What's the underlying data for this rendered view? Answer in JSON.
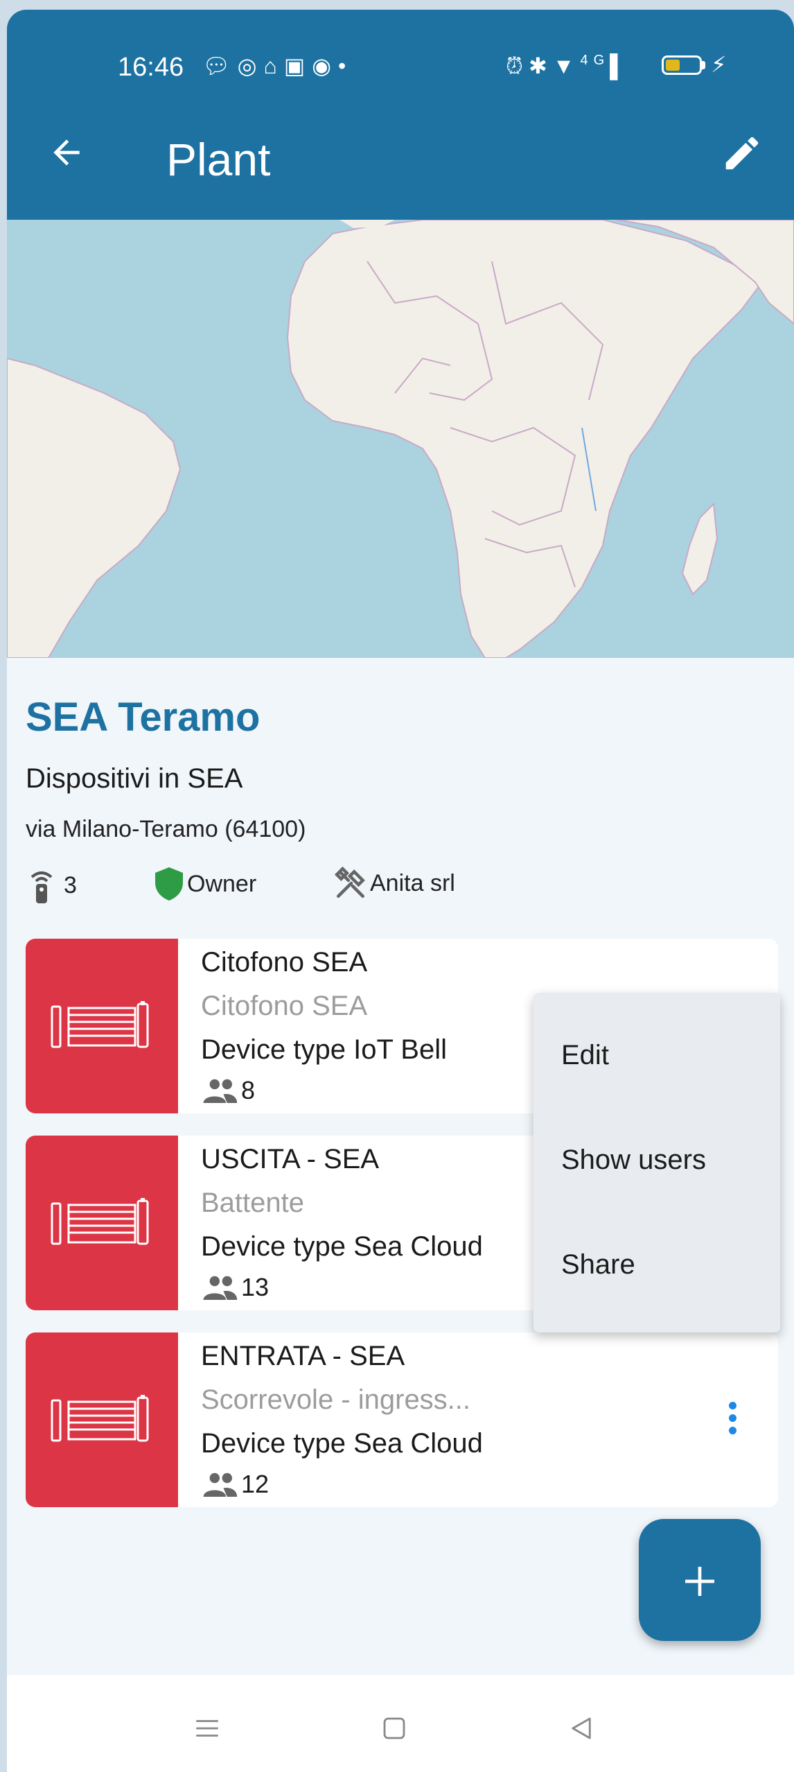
{
  "status_bar": {
    "time": "16:46",
    "left_icons": [
      "chat-bubble-icon",
      "instagram-icon",
      "home-icon",
      "linkedin-icon",
      "profile-app-icon",
      "dot-icon"
    ],
    "right_icons": [
      "alarm-icon",
      "bluetooth-icon",
      "location-icon",
      "signal-icon",
      "battery-icon",
      "charging-icon"
    ],
    "network_label": "4G"
  },
  "app_bar": {
    "title": "Plant",
    "back_icon": "arrow-back-icon",
    "edit_icon": "pencil-icon"
  },
  "plant": {
    "name": "SEA Teramo",
    "description": "Dispositivi in SEA",
    "address": "via Milano-Teramo (64100)",
    "device_count": "3",
    "role": "Owner",
    "installer": "Anita srl"
  },
  "devices": [
    {
      "name": "Citofono SEA",
      "subtitle": "Citofono SEA",
      "type": "Device type IoT Bell",
      "users": "8"
    },
    {
      "name": "USCITA - SEA",
      "subtitle": "Battente",
      "type": "Device type Sea Cloud",
      "users": "13"
    },
    {
      "name": "ENTRATA - SEA",
      "subtitle": "Scorrevole - ingress...",
      "type": "Device type Sea Cloud",
      "users": "12"
    }
  ],
  "context_menu": {
    "items": [
      {
        "label": "Edit"
      },
      {
        "label": "Show users"
      },
      {
        "label": "Share"
      }
    ]
  },
  "fab": {
    "icon": "plus-icon"
  },
  "colors": {
    "primary": "#1d72a2",
    "device_red": "#dc3545",
    "owner_green": "#2e9b45",
    "kebab_blue": "#1e88e5",
    "map_water": "#aad3df",
    "map_land": "#f2efe9"
  }
}
